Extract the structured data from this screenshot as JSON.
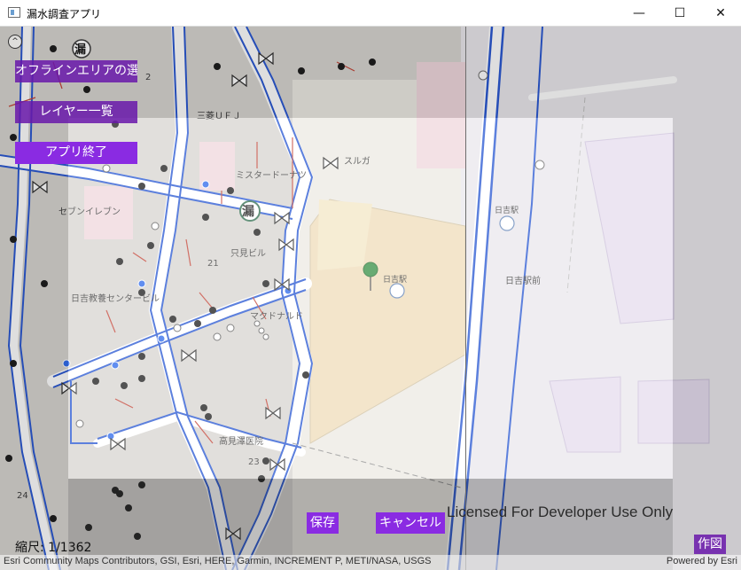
{
  "window": {
    "title": "漏水調査アプリ",
    "minimize_glyph": "—",
    "maximize_glyph": "☐",
    "close_glyph": "✕"
  },
  "side_menu": {
    "collapse_glyph": "^",
    "offline_area_label": "オフラインエリアの選択",
    "layer_list_label": "レイヤー一覧",
    "exit_label": "アプリ終了"
  },
  "map_labels": {
    "mitsubishi": "三菱ＵＦＪ",
    "suruga": "スルガ",
    "mister_donut": "ミスタードーナツ",
    "seven_eleven": "セブンイレブン",
    "tadami_bldg": "只見ビル",
    "block21": "21",
    "block2": "2",
    "hiyoshi_center": "日吉教養センタービル",
    "mcdonalds": "マクドナルド",
    "hiyoshi_station_1": "日吉駅",
    "hiyoshi_station_2": "日吉駅",
    "hiyoshi_ekimae": "日吉駅前",
    "takamizawa": "高見澤医院",
    "block23": "23",
    "block24": "24",
    "leak_marker_glyph": "漏"
  },
  "actions": {
    "save_label": "保存",
    "cancel_label": "キャンセル",
    "draw_label": "作図"
  },
  "license_text": "Licensed For Developer Use Only",
  "scale_text": "縮尺: 1/1362",
  "attribution": "Esri Community Maps Contributors, GSI, Esri, HERE, Garmin, INCREMENT P, METI/NASA, USGS",
  "powered_by": "Powered by Esri",
  "colors": {
    "accent_purple": "#8a2be2",
    "pipe_blue": "#1e4fd0",
    "pipe_red": "#c0392b",
    "marker_green": "#2e8b3d"
  }
}
